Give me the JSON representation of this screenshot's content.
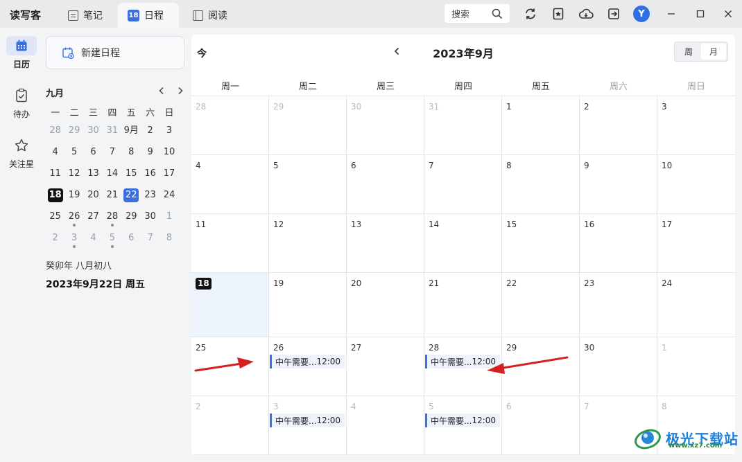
{
  "app": {
    "name": "读写客"
  },
  "tabs": [
    {
      "label": "笔记",
      "icon": "note-icon"
    },
    {
      "label": "日程",
      "icon": "calendar-tab-icon",
      "badge": "18",
      "active": true
    },
    {
      "label": "阅读",
      "icon": "book-icon"
    }
  ],
  "toolbar": {
    "search_label": "搜索",
    "avatar_letter": "Y"
  },
  "sidebar": {
    "items": [
      {
        "label": "日历",
        "icon": "calendar-icon",
        "active": true
      },
      {
        "label": "待办",
        "icon": "todo-icon"
      },
      {
        "label": "关注星",
        "icon": "star-icon"
      }
    ]
  },
  "mini_calendar": {
    "new_label": "新建日程",
    "month_label": "九月",
    "weekdays": [
      "一",
      "二",
      "三",
      "四",
      "五",
      "六",
      "日"
    ],
    "weeks": [
      [
        {
          "d": "28",
          "dim": true
        },
        {
          "d": "29",
          "dim": true
        },
        {
          "d": "30",
          "dim": true
        },
        {
          "d": "31",
          "dim": true
        },
        {
          "d": "9月"
        },
        {
          "d": "2"
        },
        {
          "d": "3"
        }
      ],
      [
        {
          "d": "4"
        },
        {
          "d": "5"
        },
        {
          "d": "6"
        },
        {
          "d": "7"
        },
        {
          "d": "8"
        },
        {
          "d": "9"
        },
        {
          "d": "10"
        }
      ],
      [
        {
          "d": "11"
        },
        {
          "d": "12"
        },
        {
          "d": "13"
        },
        {
          "d": "14"
        },
        {
          "d": "15"
        },
        {
          "d": "16"
        },
        {
          "d": "17"
        }
      ],
      [
        {
          "d": "18",
          "today": true
        },
        {
          "d": "19"
        },
        {
          "d": "20"
        },
        {
          "d": "21"
        },
        {
          "d": "22",
          "selected": true
        },
        {
          "d": "23"
        },
        {
          "d": "24"
        }
      ],
      [
        {
          "d": "25"
        },
        {
          "d": "26",
          "dot": true
        },
        {
          "d": "27"
        },
        {
          "d": "28",
          "dot": true
        },
        {
          "d": "29"
        },
        {
          "d": "30"
        },
        {
          "d": "1",
          "dim": true
        }
      ],
      [
        {
          "d": "2",
          "dim": true
        },
        {
          "d": "3",
          "dim": true,
          "dot": true
        },
        {
          "d": "4",
          "dim": true
        },
        {
          "d": "5",
          "dim": true,
          "dot": true
        },
        {
          "d": "6",
          "dim": true
        },
        {
          "d": "7",
          "dim": true
        },
        {
          "d": "8",
          "dim": true
        }
      ]
    ],
    "lunar_text": "癸卯年  八月初八",
    "full_date": "2023年9月22日  周五"
  },
  "calendar": {
    "today_label": "今",
    "title": "2023年9月",
    "view_week": "周",
    "view_month": "月",
    "active_view": "月",
    "weekdays": [
      {
        "label": "周一"
      },
      {
        "label": "周二"
      },
      {
        "label": "周三"
      },
      {
        "label": "周四"
      },
      {
        "label": "周五"
      },
      {
        "label": "周六",
        "weekend": true
      },
      {
        "label": "周日",
        "weekend": true
      }
    ],
    "weeks": [
      [
        {
          "d": "28",
          "dim": true
        },
        {
          "d": "29",
          "dim": true
        },
        {
          "d": "30",
          "dim": true
        },
        {
          "d": "31",
          "dim": true
        },
        {
          "d": "1"
        },
        {
          "d": "2"
        },
        {
          "d": "3"
        }
      ],
      [
        {
          "d": "4"
        },
        {
          "d": "5"
        },
        {
          "d": "6"
        },
        {
          "d": "7"
        },
        {
          "d": "8"
        },
        {
          "d": "9"
        },
        {
          "d": "10"
        }
      ],
      [
        {
          "d": "11"
        },
        {
          "d": "12"
        },
        {
          "d": "13"
        },
        {
          "d": "14"
        },
        {
          "d": "15"
        },
        {
          "d": "16"
        },
        {
          "d": "17"
        }
      ],
      [
        {
          "d": "18",
          "today": true
        },
        {
          "d": "19"
        },
        {
          "d": "20"
        },
        {
          "d": "21"
        },
        {
          "d": "22"
        },
        {
          "d": "23"
        },
        {
          "d": "24"
        }
      ],
      [
        {
          "d": "25"
        },
        {
          "d": "26",
          "event": {
            "title": "中午需要...",
            "time": "12:00"
          }
        },
        {
          "d": "27"
        },
        {
          "d": "28",
          "event": {
            "title": "中午需要...",
            "time": "12:00"
          }
        },
        {
          "d": "29"
        },
        {
          "d": "30"
        },
        {
          "d": "1",
          "dim": true
        }
      ],
      [
        {
          "d": "2",
          "dim": true
        },
        {
          "d": "3",
          "dim": true,
          "event": {
            "title": "中午需要...",
            "time": "12:00"
          }
        },
        {
          "d": "4",
          "dim": true
        },
        {
          "d": "5",
          "dim": true,
          "event": {
            "title": "中午需要...",
            "time": "12:00"
          }
        },
        {
          "d": "6",
          "dim": true
        },
        {
          "d": "7",
          "dim": true
        },
        {
          "d": "8",
          "dim": true
        }
      ]
    ]
  },
  "watermark": {
    "text": "极光下载站",
    "url": "www.xz7.com"
  },
  "colors": {
    "accent": "#3b6fe0",
    "annotation_arrow": "#d42020",
    "today_bg": "#eef4fc"
  }
}
